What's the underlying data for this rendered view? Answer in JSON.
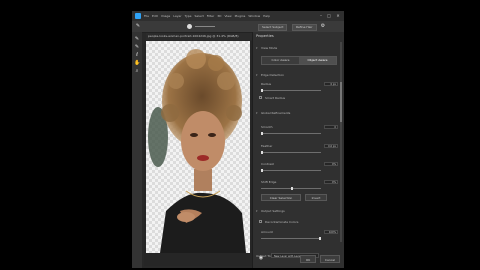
{
  "menubar": {
    "items": [
      "File",
      "Edit",
      "Image",
      "Layer",
      "Type",
      "Select",
      "Filter",
      "3D",
      "View",
      "Plugins",
      "Window",
      "Help"
    ],
    "controls": [
      "–",
      "□",
      "✕"
    ]
  },
  "options_bar": {
    "select_subject": "Select Subject",
    "refine_hair": "Refine Hair"
  },
  "document_tab": "people-looks-woman-portrait-1004246.jpg @ 31.4% (RGB/8)",
  "tools": [
    "brush-tool-icon",
    "quick-selection-icon",
    "lasso-icon",
    "hand-icon",
    "zoom-icon"
  ],
  "panel": {
    "title": "Properties",
    "view_mode": "View Mode",
    "segmented": [
      "Color Aware",
      "Object Aware"
    ],
    "edge_detection": "Edge Detection",
    "radius_label": "Radius",
    "radius_value": "0 px",
    "smart_radius": "Smart Radius",
    "global_refinements": "Global Refinements",
    "smooth_label": "Smooth",
    "smooth_value": "0",
    "feather_label": "Feather",
    "feather_value": "0.0 px",
    "contrast_label": "Contrast",
    "contrast_value": "0%",
    "shift_edge_label": "Shift Edge",
    "shift_edge_value": "0%",
    "clear_selection": "Clear Selection",
    "invert": "Invert",
    "output_settings": "Output Settings",
    "decontaminate": "Decontaminate Colors",
    "amount_label": "Amount",
    "amount_value": "100%",
    "output_to_label": "Output To:",
    "output_to_value": "New Layer with Layer Mask",
    "ok": "OK",
    "cancel": "Cancel"
  },
  "colors": {
    "accent": "#2fa3f7",
    "panel_bg": "#303030",
    "app_bg": "#282828"
  }
}
